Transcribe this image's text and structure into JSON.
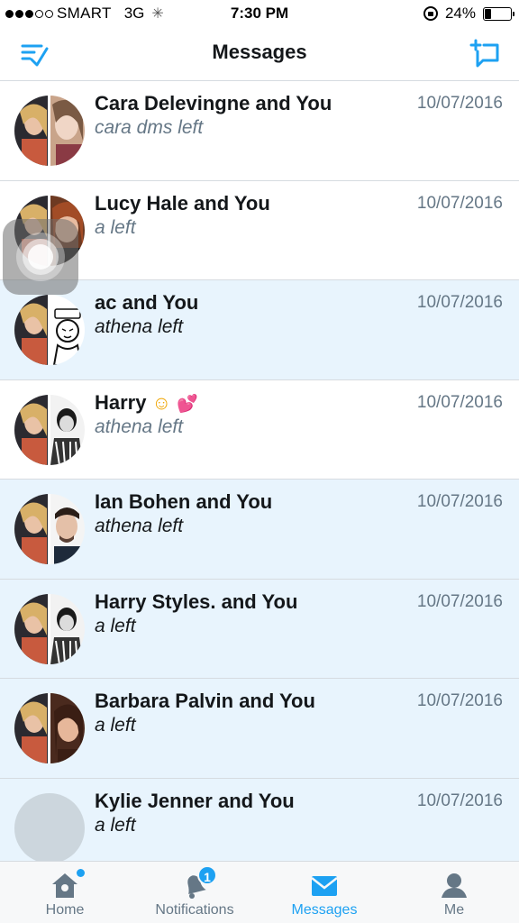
{
  "status_bar": {
    "carrier": "SMART",
    "network": "3G",
    "time": "7:30 PM",
    "battery_text": "24%",
    "battery_level": 0.24
  },
  "header": {
    "title": "Messages",
    "accent_color": "#1da1f2"
  },
  "conversations": [
    {
      "name": "Cara Delevingne and You",
      "preview": "cara dms left",
      "date": "10/07/2016",
      "unread": false
    },
    {
      "name": "Lucy Hale and You",
      "preview": "a left",
      "date": "10/07/2016",
      "unread": false
    },
    {
      "name": "ac and You",
      "preview": "athena left",
      "date": "10/07/2016",
      "unread": true
    },
    {
      "name": "Harry",
      "preview": "athena left",
      "date": "10/07/2016",
      "unread": false
    },
    {
      "name": "Ian Bohen and You",
      "preview": "athena left",
      "date": "10/07/2016",
      "unread": true
    },
    {
      "name": "Harry Styles. and You",
      "preview": "a left",
      "date": "10/07/2016",
      "unread": true
    },
    {
      "name": "Barbara Palvin and You",
      "preview": "a left",
      "date": "10/07/2016",
      "unread": true
    },
    {
      "name": "Kylie Jenner and You",
      "preview": "a left",
      "date": "10/07/2016",
      "unread": true
    }
  ],
  "emoji": {
    "smile": "☺",
    "hearts": "💕"
  },
  "tabs": [
    {
      "label": "Home",
      "icon": "home-icon",
      "active": false
    },
    {
      "label": "Notifications",
      "icon": "bell-icon",
      "active": false,
      "badge": "1"
    },
    {
      "label": "Messages",
      "icon": "envelope-icon",
      "active": true
    },
    {
      "label": "Me",
      "icon": "person-icon",
      "active": false
    }
  ]
}
